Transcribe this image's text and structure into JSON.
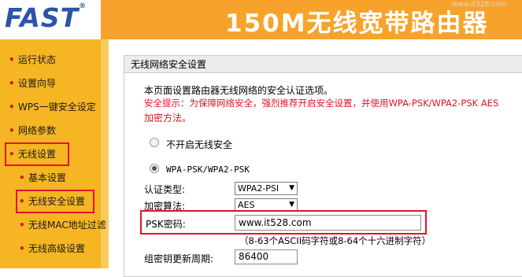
{
  "header": {
    "logo": "FAST",
    "logo_reg": "®",
    "title": "150M无线宽带路由器",
    "watermark": "www.it528.com"
  },
  "sidebar": {
    "items": [
      {
        "label": "运行状态"
      },
      {
        "label": "设置向导"
      },
      {
        "label": "WPS一键安全设定"
      },
      {
        "label": "网络参数"
      },
      {
        "label": "无线设置"
      },
      {
        "label": "基本设置"
      },
      {
        "label": "无线安全设置"
      },
      {
        "label": "无线MAC地址过滤"
      },
      {
        "label": "无线高级设置"
      }
    ]
  },
  "panel": {
    "title": "无线网络安全设置",
    "intro": "本页面设置路由器无线网络的安全认证选项。",
    "tip_line1": "安全提示：为保障网络安全，强烈推荐开启安全设置，并使用WPA-PSK/WPA2-PSK AES",
    "tip_line2": "加密方法。",
    "option_off": "不开启无线安全",
    "option_wpa": "WPA-PSK/WPA2-PSK",
    "auth_label": "认证类型:",
    "auth_value": "WPA2-PSI",
    "enc_label": "加密算法:",
    "enc_value": "AES",
    "psk_label": "PSK密码:",
    "psk_value": "www.it528.com",
    "psk_hint": "（8-63个ASCII码字符或8-64个十六进制字符）",
    "renew_label": "组密钥更新周期:",
    "renew_value": "86400"
  },
  "colors": {
    "header": "#f7a32b",
    "sidebar": "#f6b523",
    "logo": "#2a55a8",
    "highlight": "#e1122a"
  }
}
